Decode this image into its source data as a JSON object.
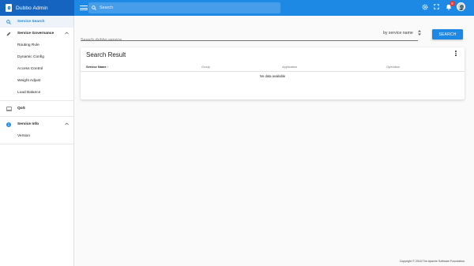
{
  "app": {
    "title": "Dubbo Admin"
  },
  "topbar": {
    "search_placeholder": "Search",
    "notifications_count": "6"
  },
  "sidebar": {
    "items": [
      {
        "label": "Service Search"
      },
      {
        "label": "Service Governance"
      },
      {
        "label": "Routing Rule"
      },
      {
        "label": "Dynamic Config"
      },
      {
        "label": "Access Control"
      },
      {
        "label": "Weight Adjust"
      },
      {
        "label": "Load Balance"
      },
      {
        "label": "QoS"
      },
      {
        "label": "Service Info"
      },
      {
        "label": "Version"
      }
    ]
  },
  "filter": {
    "input_placeholder": "Search dubbo service",
    "select_value": "by service name",
    "search_button": "SEARCH"
  },
  "results": {
    "title": "Search Result",
    "columns": [
      "Service Name",
      "Group",
      "Application",
      "Operation"
    ],
    "sort_indicator": "↑",
    "empty_text": "No data available"
  },
  "footer": {
    "text": "Copyright © 2018 The Apache Software Foundation."
  },
  "colors": {
    "primary": "#1e88e5",
    "brand_dark": "#1565c0",
    "badge": "#e53935"
  }
}
